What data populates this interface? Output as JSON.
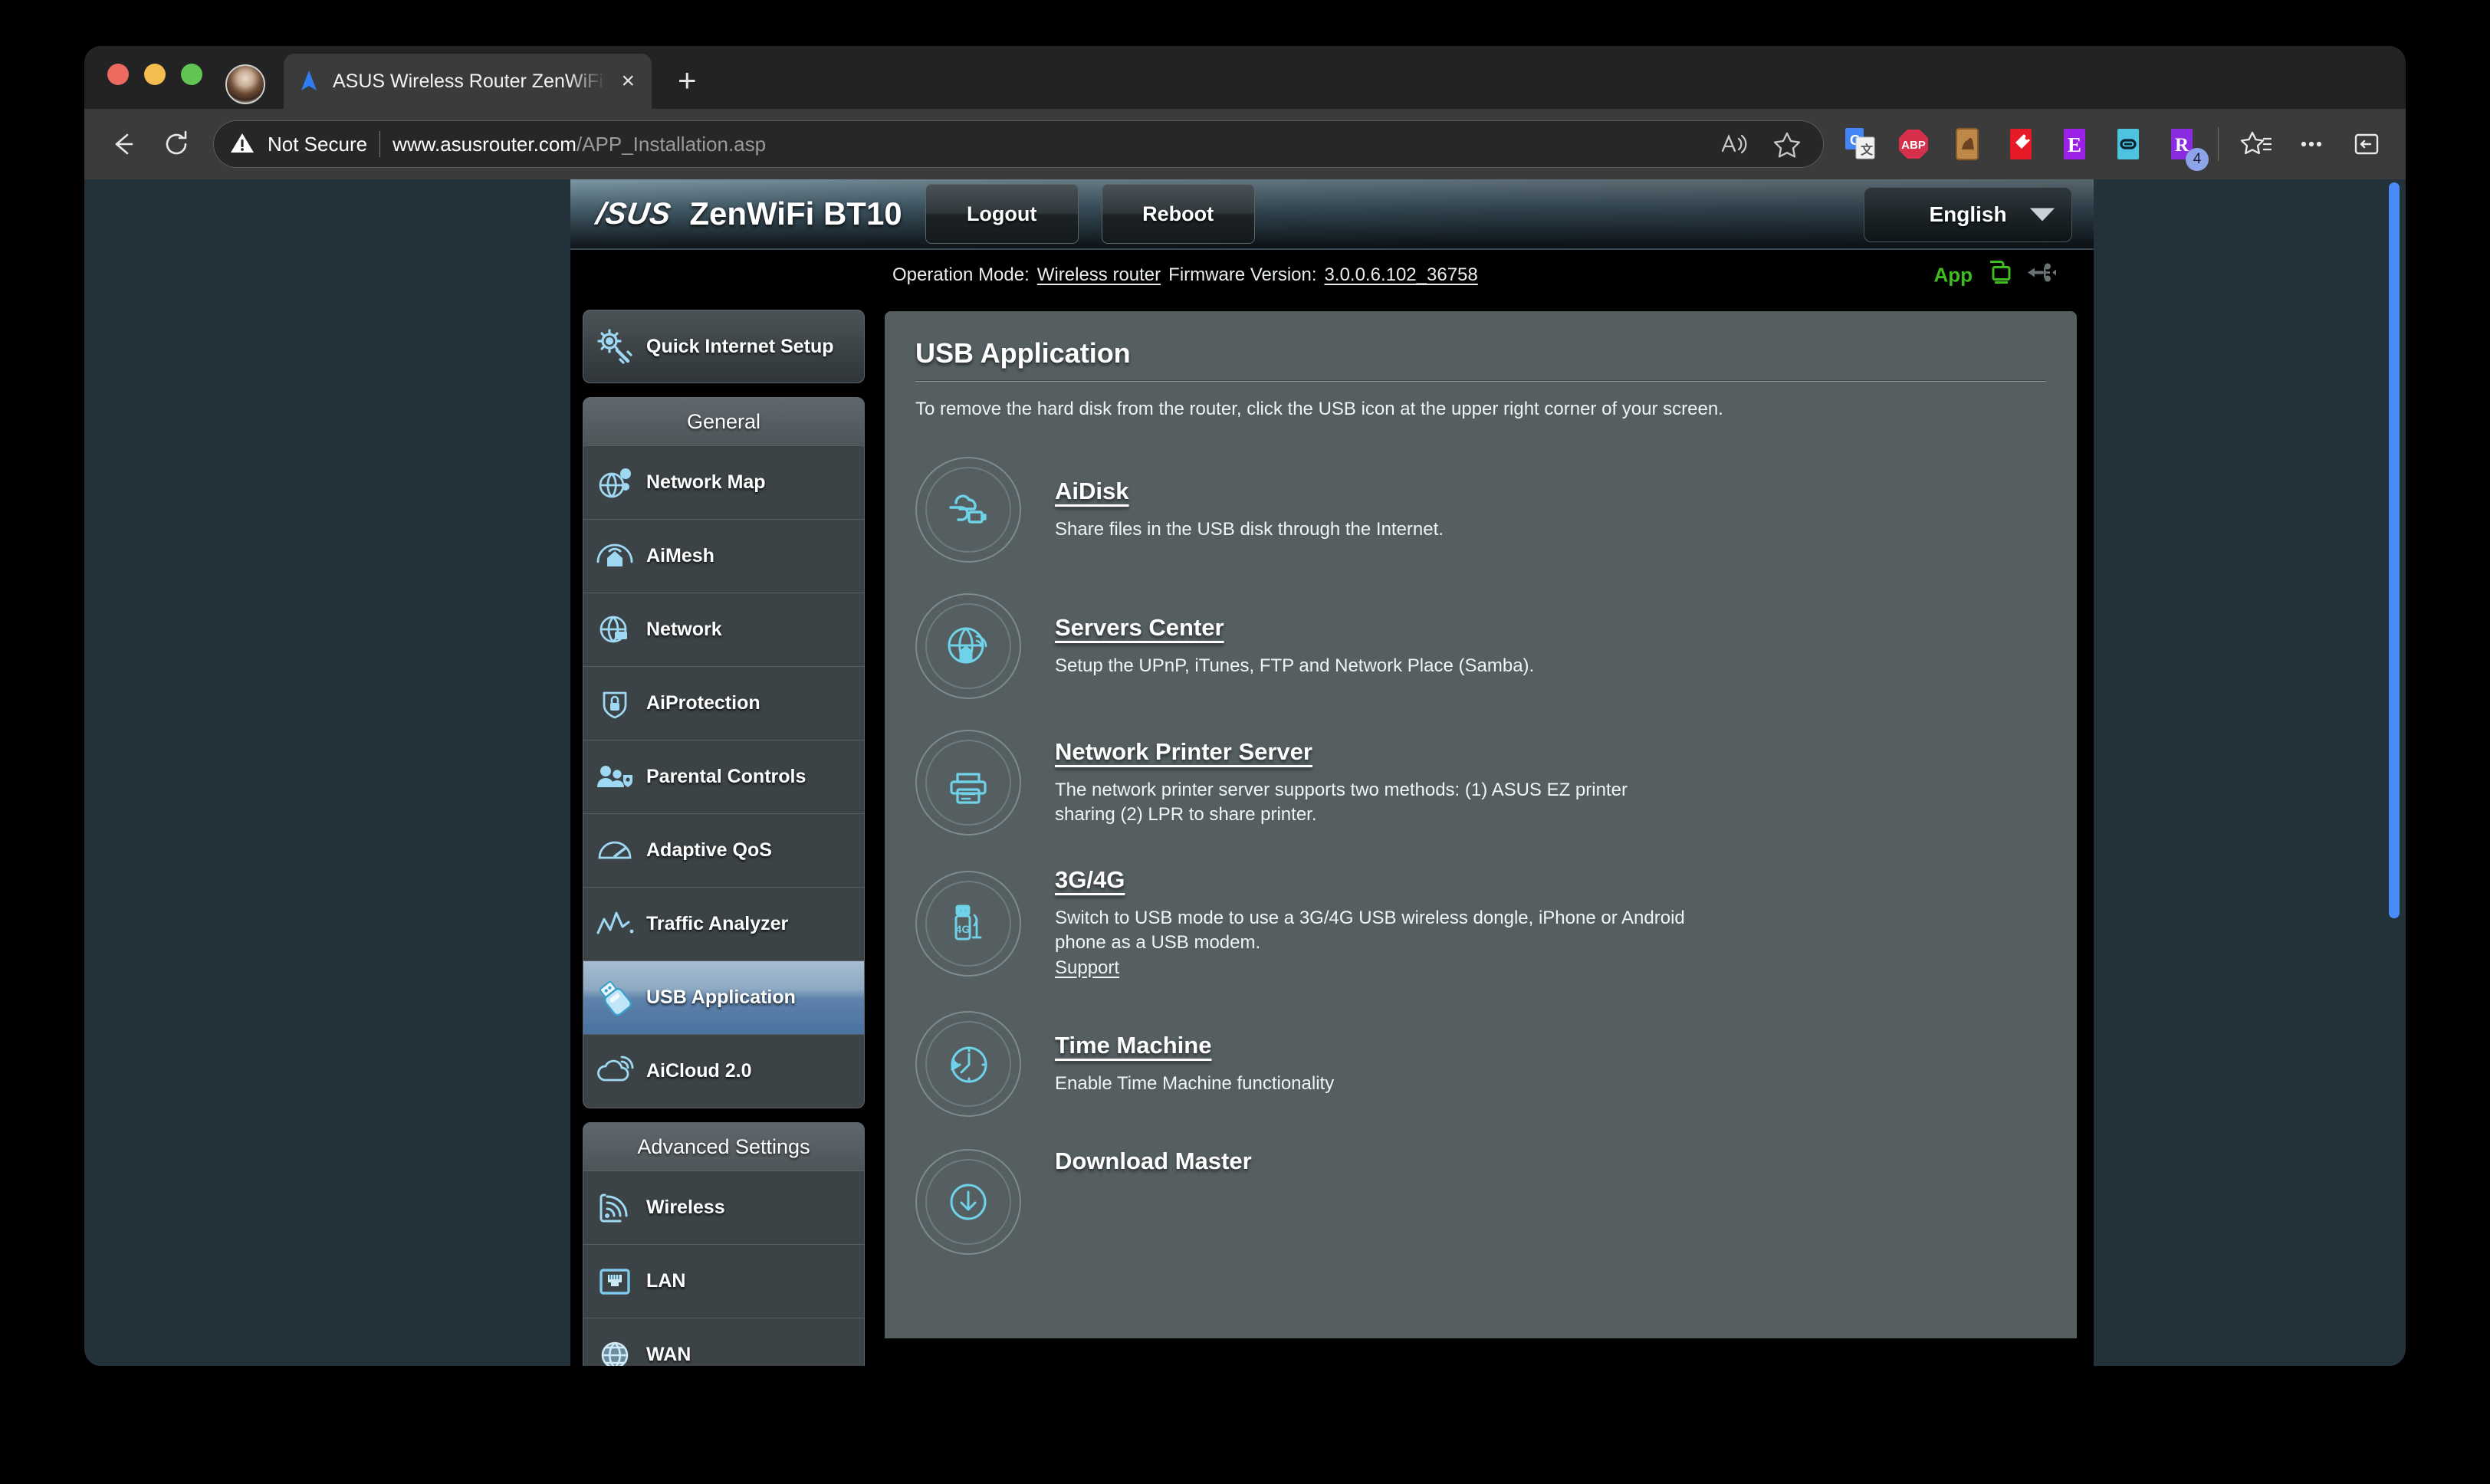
{
  "browser": {
    "tab": {
      "title": "ASUS Wireless Router ZenWiFi",
      "favicon_name": "edge-logo-icon",
      "close_label": "×"
    },
    "new_tab_label": "+",
    "toolbar": {
      "back_icon": "back-arrow-icon",
      "reload_icon": "reload-icon",
      "security_label": "Not Secure",
      "url_host": "www.asusrouter.com",
      "url_path": "/APP_Installation.asp",
      "read_aloud_icon": "read-aloud-icon",
      "favorite_icon": "star-icon",
      "collections_icon": "collections-icon",
      "more_icon": "more-ellipsis-icon",
      "split_screen_icon": "sidebar-icon",
      "extensions": [
        {
          "name": "google-translate-extension",
          "label": "G"
        },
        {
          "name": "adblock-plus-extension",
          "label": "ABP"
        },
        {
          "name": "camel-extension",
          "label": ""
        },
        {
          "name": "honey-extension",
          "label": ""
        },
        {
          "name": "e-extension",
          "label": "E"
        },
        {
          "name": "link-extension",
          "label": ""
        },
        {
          "name": "r-extension",
          "label": "R",
          "badge": "4"
        }
      ]
    }
  },
  "router": {
    "brand": "/SUS",
    "model": "ZenWiFi BT10",
    "logout_label": "Logout",
    "reboot_label": "Reboot",
    "language": "English",
    "info": {
      "operation_mode_label": "Operation Mode:",
      "operation_mode_value": "Wireless router",
      "firmware_label": "Firmware Version:",
      "firmware_value": "3.0.0.6.102_36758",
      "app_label": "App",
      "app_icon": "monitor-app-icon",
      "usb_icon": "usb-eject-icon"
    },
    "sidebar": {
      "quick_setup": {
        "label": "Quick Internet Setup",
        "icon": "gear-wand-icon"
      },
      "general_header": "General",
      "general_items": [
        {
          "label": "Network Map",
          "icon": "network-map-icon",
          "active": false
        },
        {
          "label": "AiMesh",
          "icon": "aimesh-icon",
          "active": false
        },
        {
          "label": "Network",
          "icon": "network-globe-icon",
          "active": false
        },
        {
          "label": "AiProtection",
          "icon": "shield-lock-icon",
          "active": false
        },
        {
          "label": "Parental Controls",
          "icon": "people-shield-icon",
          "active": false
        },
        {
          "label": "Adaptive QoS",
          "icon": "gauge-icon",
          "active": false
        },
        {
          "label": "Traffic Analyzer",
          "icon": "traffic-chart-icon",
          "active": false
        },
        {
          "label": "USB Application",
          "icon": "usb-drive-icon",
          "active": true
        },
        {
          "label": "AiCloud 2.0",
          "icon": "cloud-wifi-icon",
          "active": false
        }
      ],
      "advanced_header": "Advanced Settings",
      "advanced_items": [
        {
          "label": "Wireless",
          "icon": "wireless-signal-icon"
        },
        {
          "label": "LAN",
          "icon": "lan-port-icon"
        },
        {
          "label": "WAN",
          "icon": "wan-globe-icon"
        }
      ]
    },
    "main": {
      "title": "USB Application",
      "note": "To remove the hard disk from the router, click the USB icon at the upper right corner of your screen.",
      "apps": [
        {
          "name": "AiDisk",
          "icon": "cloud-usb-icon",
          "desc": "Share files in the USB disk through the Internet."
        },
        {
          "name": "Servers Center",
          "icon": "globe-home-server-icon",
          "desc": "Setup the UPnP, iTunes, FTP and Network Place (Samba)."
        },
        {
          "name": "Network Printer Server",
          "icon": "printer-icon",
          "desc": "The network printer server supports two methods: (1) ASUS EZ printer sharing (2) LPR to share printer."
        },
        {
          "name": "3G/4G",
          "icon": "usb-4g-dongle-icon",
          "desc": "Switch to USB mode to use a 3G/4G USB wireless dongle, iPhone or Android phone as a USB modem.",
          "link_label": "Support"
        },
        {
          "name": "Time Machine",
          "icon": "clock-rewind-icon",
          "desc": "Enable Time Machine functionality"
        },
        {
          "name": "Download Master",
          "icon": "download-icon",
          "desc": ""
        }
      ]
    }
  },
  "colors": {
    "accent_blue": "#4a8cf7",
    "router_panel": "#555f61",
    "active_item": "#4a72a0",
    "app_green": "#3fbd1f",
    "icon_cyan": "#6fd2e8"
  }
}
